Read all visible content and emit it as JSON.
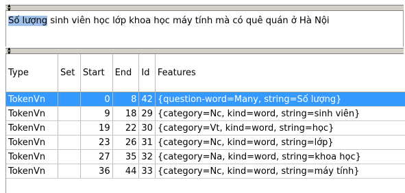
{
  "text_pane": {
    "highlighted": "Số lượng",
    "rest": " sinh viên học lớp khoa học máy tính mà có quê quán ở Hà Nội"
  },
  "table": {
    "headers": [
      "Type",
      "Set",
      "Start",
      "End",
      "Id",
      "Features"
    ],
    "selected_row": 0,
    "rows": [
      [
        "TokenVn",
        "",
        "0",
        "8",
        "42",
        "{question-word=Many, string=Số lượng}"
      ],
      [
        "TokenVn",
        "",
        "9",
        "18",
        "29",
        "{category=Nc, kind=word, string=sinh viên}"
      ],
      [
        "TokenVn",
        "",
        "19",
        "22",
        "30",
        "{category=Vt, kind=word, string=học}"
      ],
      [
        "TokenVn",
        "",
        "23",
        "26",
        "31",
        "{category=Nc, kind=word, string=lớp}"
      ],
      [
        "TokenVn",
        "",
        "27",
        "35",
        "32",
        "{category=Na, kind=word, string=khoa học}"
      ],
      [
        "TokenVn",
        "",
        "36",
        "44",
        "33",
        "{category=Nc, kind=word, string=máy tính}"
      ]
    ]
  },
  "colors": {
    "selection": "#3399ff",
    "text_highlight": "#9fc0ea"
  }
}
